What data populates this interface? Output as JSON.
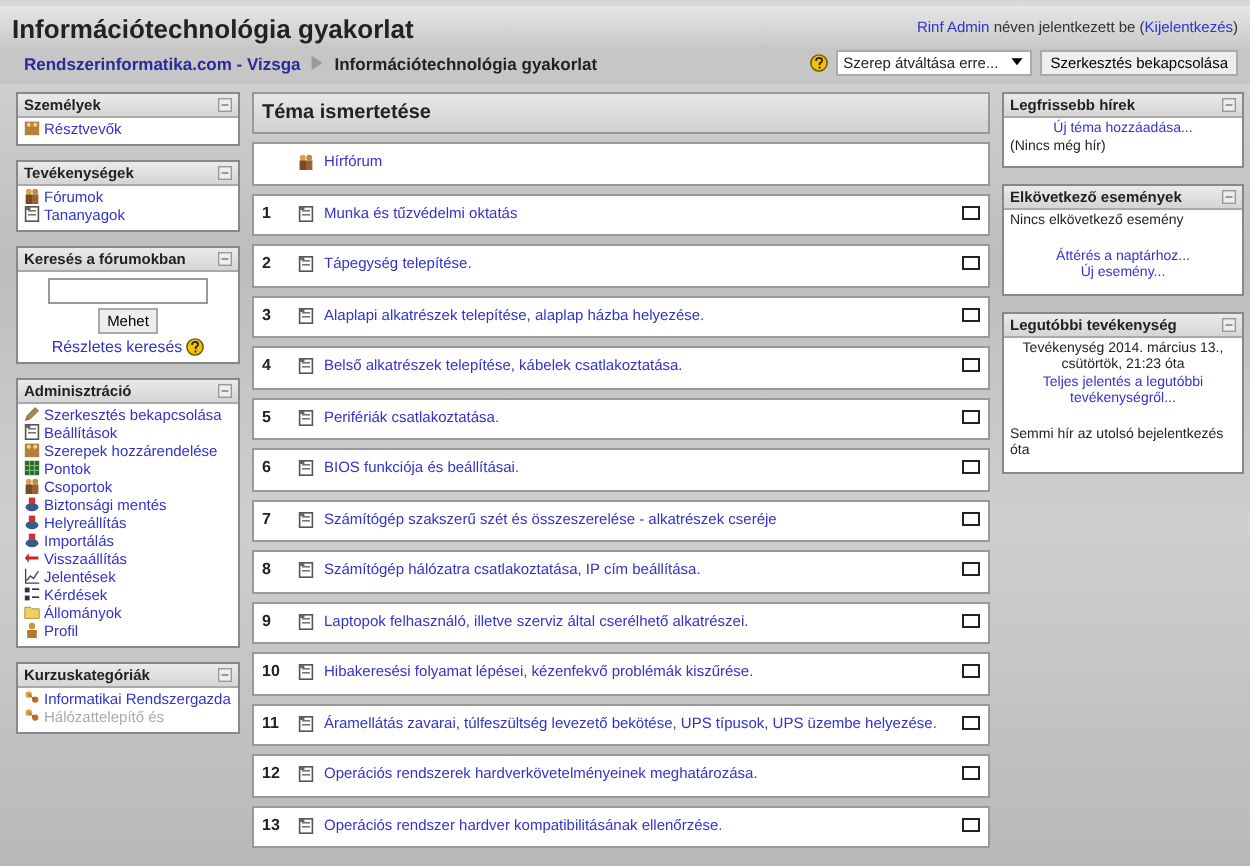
{
  "header": {
    "title": "Információtechnológia gyakorlat",
    "login": {
      "user": "Rinf Admin",
      "middle": " néven jelentkezett be (",
      "logout": "Kijelentkezés",
      "end": ")"
    }
  },
  "navbar": {
    "breadcrumb": [
      {
        "text": "Rendszerinformatika.com - Vizsga",
        "kind": "link"
      },
      {
        "text": "Információtechnológia gyakorlat",
        "kind": "current"
      }
    ],
    "role_select": "Szerep átváltása erre...",
    "edit_button": "Szerkesztés bekapcsolása"
  },
  "left_blocks": [
    {
      "kind": "links",
      "title": "Személyek",
      "items": [
        {
          "kind": "people",
          "text": "Résztvevők",
          "disabled": false
        }
      ]
    },
    {
      "kind": "links",
      "title": "Tevékenységek",
      "items": [
        {
          "kind": "forum",
          "text": "Fórumok",
          "disabled": false
        },
        {
          "kind": "page",
          "text": "Tananyagok",
          "disabled": false
        }
      ]
    },
    {
      "kind": "search",
      "title": "Keresés a fórumokban",
      "button": "Mehet",
      "link": "Részletes keresés"
    },
    {
      "kind": "links",
      "title": "Adminisztráció",
      "items": [
        {
          "kind": "edit",
          "text": "Szerkesztés bekapcsolása",
          "disabled": false
        },
        {
          "kind": "page",
          "text": "Beállítások",
          "disabled": false
        },
        {
          "kind": "people",
          "text": "Szerepek hozzárendelése",
          "disabled": false
        },
        {
          "kind": "grades",
          "text": "Pontok",
          "disabled": false
        },
        {
          "kind": "forum",
          "text": "Csoportok",
          "disabled": false
        },
        {
          "kind": "backup",
          "text": "Biztonsági mentés",
          "disabled": false
        },
        {
          "kind": "backup",
          "text": "Helyreállítás",
          "disabled": false
        },
        {
          "kind": "backup",
          "text": "Importálás",
          "disabled": false
        },
        {
          "kind": "restore",
          "text": "Visszaállítás",
          "disabled": false
        },
        {
          "kind": "reports",
          "text": "Jelentések",
          "disabled": false
        },
        {
          "kind": "questions",
          "text": "Kérdések",
          "disabled": false
        },
        {
          "kind": "folder",
          "text": "Állományok",
          "disabled": false
        },
        {
          "kind": "profile",
          "text": "Profil",
          "disabled": false
        }
      ]
    },
    {
      "kind": "links",
      "title": "Kurzuskategóriák",
      "items": [
        {
          "kind": "category",
          "text": "Informatikai Rendszergazda",
          "disabled": false
        },
        {
          "kind": "category",
          "text": "Hálózattelepítő és",
          "disabled": true
        }
      ]
    }
  ],
  "main": {
    "title": "Téma ismertetése",
    "forum": "Hírfórum",
    "topics": [
      {
        "number": "1",
        "title": "Munka és tűzvédelmi oktatás",
        "checked": false
      },
      {
        "number": "2",
        "title": "Tápegység telepítése.",
        "checked": false
      },
      {
        "number": "3",
        "title": "Alaplapi alkatrészek telepítése, alaplap házba helyezése.",
        "checked": false
      },
      {
        "number": "4",
        "title": "Belső alkatrészek telepítése, kábelek csatlakoztatása.",
        "checked": false
      },
      {
        "number": "5",
        "title": "Perifériák csatlakoztatása.",
        "checked": false
      },
      {
        "number": "6",
        "title": "BIOS funkciója és beállításai.",
        "checked": false
      },
      {
        "number": "7",
        "title": "Számítógép szakszerű szét és összeszerelése - alkatrészek cseréje",
        "checked": false
      },
      {
        "number": "8",
        "title": "Számítógép hálózatra csatlakoztatása, IP cím beállítása.",
        "checked": false
      },
      {
        "number": "9",
        "title": "Laptopok felhasználó, illetve szerviz által cserélhető alkatrészei.",
        "checked": false
      },
      {
        "number": "10",
        "title": "Hibakeresési folyamat lépései, kézenfekvő problémák kiszűrése.",
        "checked": false
      },
      {
        "number": "11",
        "title": "Áramellátás zavarai, túlfeszültség levezető bekötése, UPS típusok, UPS üzembe helyezése.",
        "checked": false
      },
      {
        "number": "12",
        "title": "Operációs rendszerek hardverkövetelményeinek meghatározása.",
        "checked": false
      },
      {
        "number": "13",
        "title": "Operációs rendszer hardver kompatibilitásának ellenőrzése.",
        "checked": false
      }
    ]
  },
  "right_blocks": [
    {
      "title": "Legfrissebb hírek",
      "items": [
        {
          "kind": "link",
          "text": "Új téma hozzáadása...",
          "centered": true
        },
        {
          "kind": "text",
          "text": "(Nincs még hír)",
          "centered": false
        }
      ]
    },
    {
      "title": "Elkövetkező események",
      "items": [
        {
          "kind": "text",
          "text": "Nincs elkövetkező esemény",
          "centered": false
        },
        {
          "kind": "gap"
        },
        {
          "kind": "link",
          "text": "Áttérés a naptárhoz...",
          "centered": true
        },
        {
          "kind": "link",
          "text": "Új esemény...",
          "centered": true
        }
      ]
    },
    {
      "title": "Legutóbbi tevékenység",
      "items": [
        {
          "kind": "text",
          "text": "Tevékenység 2014. március 13., csütörtök, 21:23 óta",
          "centered": true
        },
        {
          "kind": "link",
          "text": "Teljes jelentés a legutóbbi tevékenységről...",
          "centered": true
        },
        {
          "kind": "gap"
        },
        {
          "kind": "text",
          "text": "Semmi hír az utolsó bejelentkezés óta",
          "centered": false
        }
      ]
    }
  ]
}
